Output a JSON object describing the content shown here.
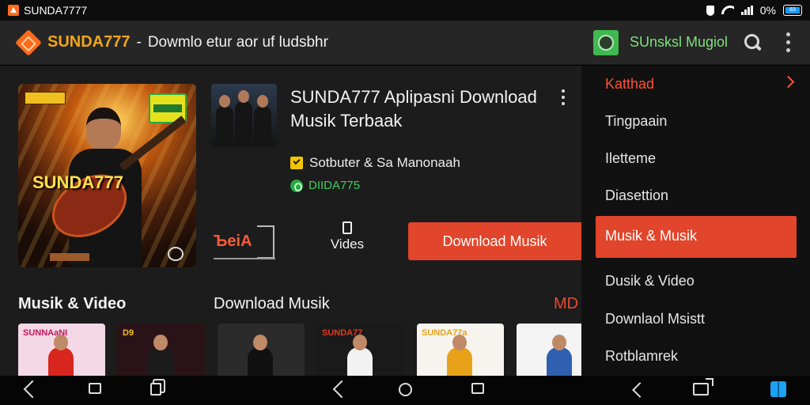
{
  "status_bar": {
    "app_name": "SUNDA7777",
    "battery_percent": "0%",
    "battery_badge": "83"
  },
  "app_bar": {
    "brand": "SUNDA777",
    "separator": "-",
    "title": "Dowmlo etur aor uf ludsbhr",
    "search_label": "SUnsksl Mugiol"
  },
  "featured": {
    "album_cover_text": "SUNDA777",
    "title": "SUNDA777 Aplipasni Download Musik Terbaak",
    "artist": "Sotbuter & Sa Manonaah",
    "channel": "DIIDA775",
    "action_bell_label": "ЪeiA",
    "action_video_label": "Vides",
    "download_button_label": "Download Musik"
  },
  "sections": {
    "left_title": "Musik & Video",
    "right_title": "Download Musik",
    "more_label": "MD"
  },
  "cards": [
    {
      "caption": "SUNNAaNI",
      "bg": "#f4d8e6",
      "caption_color": "#c0185a",
      "shirt": "#d8261e"
    },
    {
      "caption": "D9",
      "bg": "#2a1318",
      "caption_color": "#f2c21d",
      "shirt": "#1b1b1b"
    },
    {
      "caption": "",
      "bg": "#2b2b2b",
      "caption_color": "#ffffff",
      "shirt": "#111111"
    },
    {
      "caption": "SUNDA77",
      "bg": "#1a1a1a",
      "caption_color": "#e33b1f",
      "shirt": "#f2f2f2"
    },
    {
      "caption": "SUNDA77a",
      "bg": "#f7f4ef",
      "caption_color": "#e8a21a",
      "shirt": "#e8a21a"
    },
    {
      "caption": "",
      "bg": "#f3f3f3",
      "caption_color": "#d01c1c",
      "shirt": "#2f5fb0"
    }
  ],
  "drawer": {
    "items": [
      "Katthad",
      "Tingpaain",
      "Iletteme",
      "Diasettion",
      "Musik & Musik",
      "Dusik & Video",
      "Downlaol Msistt",
      "Rotblamrek"
    ],
    "active_index": 4
  },
  "colors": {
    "accent": "#e1452b",
    "brand": "#f2a51c",
    "search_green": "#7fe07c"
  }
}
